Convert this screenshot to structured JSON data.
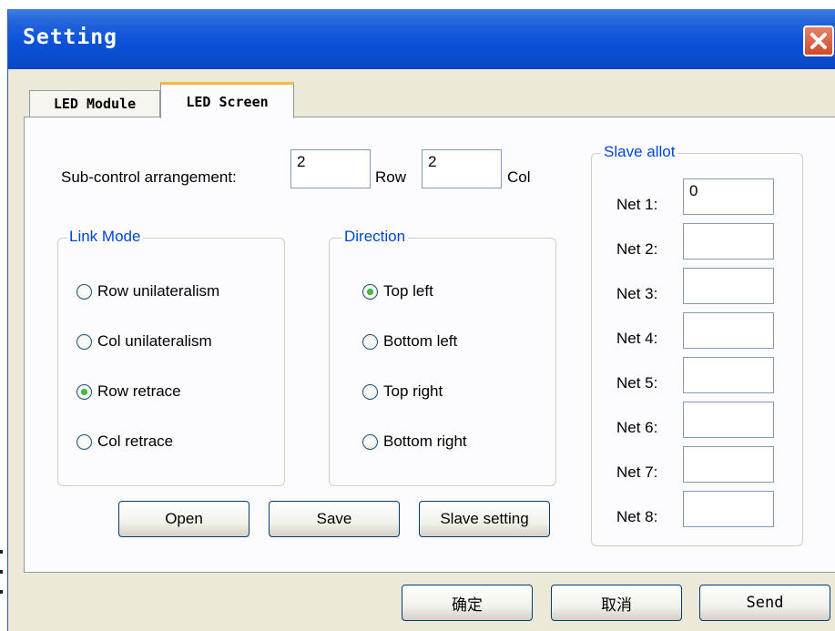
{
  "window": {
    "title": "Setting"
  },
  "tabs": [
    {
      "label": "LED Module",
      "active": false
    },
    {
      "label": "LED Screen",
      "active": true
    }
  ],
  "arrangement": {
    "label": "Sub-control arrangement:",
    "row_value": "2",
    "row_label": "Row",
    "col_value": "2",
    "col_label": "Col"
  },
  "link_mode": {
    "title": "Link Mode",
    "options": [
      {
        "label": "Row unilateralism",
        "checked": false
      },
      {
        "label": "Col unilateralism",
        "checked": false
      },
      {
        "label": "Row retrace",
        "checked": true
      },
      {
        "label": "Col retrace",
        "checked": false
      }
    ]
  },
  "direction": {
    "title": "Direction",
    "options": [
      {
        "label": "Top left",
        "checked": true
      },
      {
        "label": "Bottom left",
        "checked": false
      },
      {
        "label": "Top right",
        "checked": false
      },
      {
        "label": "Bottom right",
        "checked": false
      }
    ]
  },
  "slave_allot": {
    "title": "Slave allot",
    "nets": [
      {
        "label": "Net 1:",
        "value": "0"
      },
      {
        "label": "Net 2:",
        "value": ""
      },
      {
        "label": "Net 3:",
        "value": ""
      },
      {
        "label": "Net 4:",
        "value": ""
      },
      {
        "label": "Net 5:",
        "value": ""
      },
      {
        "label": "Net 6:",
        "value": ""
      },
      {
        "label": "Net 7:",
        "value": ""
      },
      {
        "label": "Net 8:",
        "value": ""
      }
    ]
  },
  "buttons": {
    "open": "Open",
    "save": "Save",
    "slave_setting": "Slave setting",
    "ok": "确定",
    "cancel": "取消",
    "send": "Send"
  },
  "icons": {
    "close": "close-icon",
    "radio": "radio-button-icon"
  },
  "colors": {
    "title_bar": "#0b52d8",
    "group_title": "#0046d5",
    "close_button": "#cf4a2a"
  }
}
